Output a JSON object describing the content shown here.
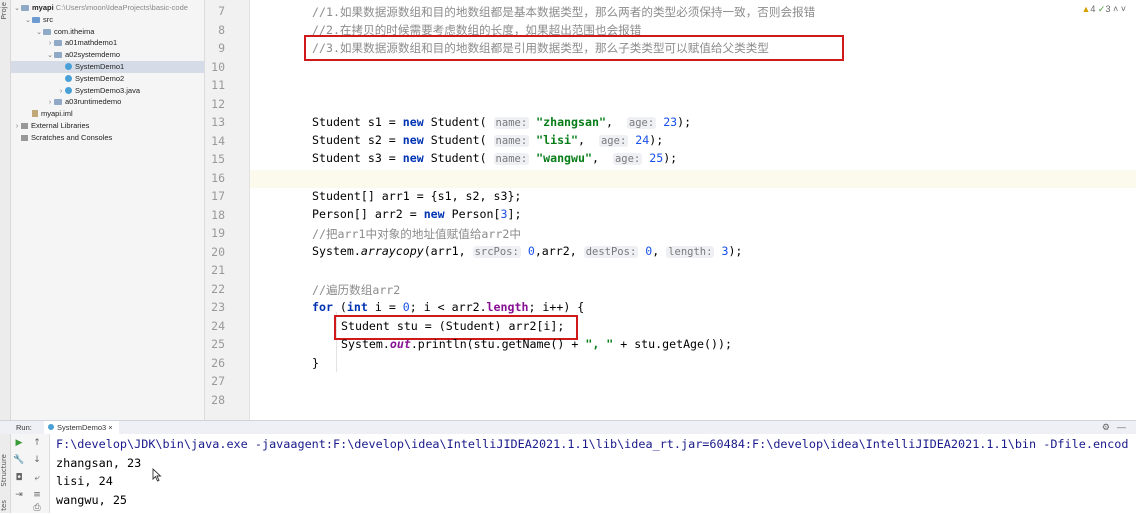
{
  "left_strip": {
    "project_label": "Proje",
    "structure_label": "Structure",
    "tabs_label": "tes"
  },
  "project_tree": [
    {
      "arrow": "v",
      "icon": "folder",
      "label": "myapi",
      "path": "C:\\Users\\moon\\IdeaProjects\\basic-code",
      "bold": true,
      "indent": 0
    },
    {
      "arrow": "v",
      "icon": "folder-src",
      "label": "src",
      "indent": 1
    },
    {
      "arrow": "v",
      "icon": "folder",
      "label": "com.itheima",
      "indent": 2
    },
    {
      "arrow": ">",
      "icon": "folder",
      "label": "a01mathdemo1",
      "indent": 3
    },
    {
      "arrow": "v",
      "icon": "folder",
      "label": "a02systemdemo",
      "indent": 3
    },
    {
      "arrow": "",
      "icon": "class",
      "label": "SystemDemo1",
      "indent": 4,
      "selected": true
    },
    {
      "arrow": "",
      "icon": "class",
      "label": "SystemDemo2",
      "indent": 4
    },
    {
      "arrow": ">",
      "icon": "class",
      "label": "SystemDemo3.java",
      "indent": 4
    },
    {
      "arrow": ">",
      "icon": "folder",
      "label": "a03runtimedemo",
      "indent": 3
    },
    {
      "arrow": "",
      "icon": "iml",
      "label": "myapi.iml",
      "indent": 1
    },
    {
      "arrow": ">",
      "icon": "lib",
      "label": "External Libraries",
      "indent": 0
    },
    {
      "arrow": "",
      "icon": "lib",
      "label": "Scratches and Consoles",
      "indent": 0
    }
  ],
  "line_numbers": [
    "7",
    "8",
    "9",
    "10",
    "11",
    "12",
    "13",
    "14",
    "15",
    "16",
    "17",
    "18",
    "19",
    "20",
    "21",
    "22",
    "23",
    "24",
    "25",
    "26",
    "27",
    "28"
  ],
  "inspections": {
    "warnings": "4",
    "ok": "3"
  },
  "code": {
    "l7": "//1.如果数据源数组和目的地数组都是基本数据类型，那么两者的类型必须保持一致，否则会报错",
    "l8": "//2.在拷贝的时候需要考虑数组的长度，如果超出范围也会报错",
    "l9": "//3.如果数据源数组和目的地数组都是引用数据类型，那么子类类型可以赋值给父类类型",
    "student": "Student",
    "new": "new",
    "name_hint": "name:",
    "age_hint": "age:",
    "s1": {
      "decl": " s1 = ",
      "name": "\"zhangsan\"",
      "age": "23"
    },
    "s2": {
      "decl": " s2 = ",
      "name": "\"lisi\"",
      "age": "24"
    },
    "s3": {
      "decl": " s3 = ",
      "name": "\"wangwu\"",
      "age": "25"
    },
    "l17": "Student[] arr1 = {s1, s2, s3};",
    "l18_a": "Person[] arr2 = ",
    "l18_b": " Person[",
    "l18_num": "3",
    "l18_c": "];",
    "l19": "//把arr1中对象的地址值赋值给arr2中",
    "l20_a": "System.",
    "l20_method": "arraycopy",
    "l20_b": "(arr1, ",
    "srcpos_hint": "srcPos:",
    "l20_src": "0",
    "l20_c": ",arr2, ",
    "destpos_hint": "destPos:",
    "l20_dest": "0",
    "l20_d": ", ",
    "length_hint": "length:",
    "l20_len": "3",
    "l20_e": ");",
    "l22": "//遍历数组arr2",
    "for": "for",
    "l23_a": " (",
    "int": "int",
    "l23_b": " i = ",
    "l23_zero": "0",
    "l23_c": "; i < arr2.",
    "length_field": "length",
    "l23_d": "; i++) {",
    "l24": "Student stu = (Student) arr2[i];",
    "l25_a": "System.",
    "out_field": "out",
    "l25_b": ".println(stu.getName() + ",
    "l25_str": "\", \"",
    "l25_c": " + stu.getAge());",
    "l26": "}"
  },
  "run": {
    "label": "Run:",
    "tab": "SystemDemo3",
    "console": [
      "F:\\develop\\JDK\\bin\\java.exe -javaagent:F:\\develop\\idea\\IntelliJIDEA2021.1.1\\lib\\idea_rt.jar=60484:F:\\develop\\idea\\IntelliJIDEA2021.1.1\\bin -Dfile.encod",
      "zhangsan, 23",
      "lisi, 24",
      "wangwu, 25"
    ]
  },
  "colors": {
    "keyword": "#0033b3",
    "string": "#067d17",
    "number": "#1750eb",
    "comment": "#8c8c8c",
    "highlight_box": "#d01919"
  }
}
